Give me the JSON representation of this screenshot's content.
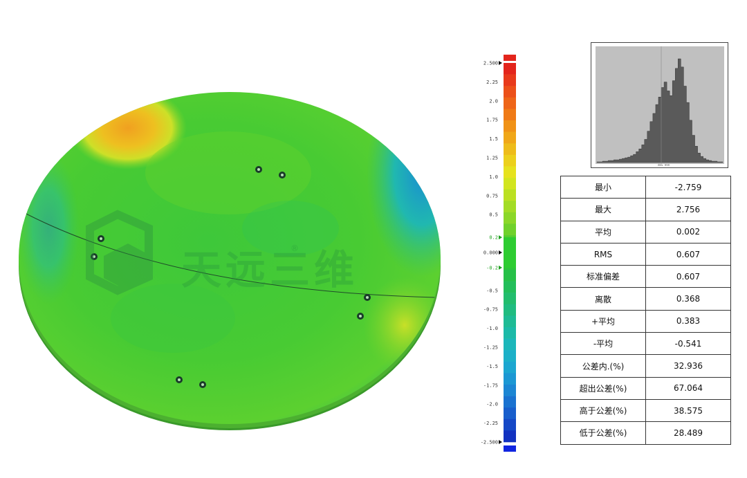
{
  "watermark": {
    "text": "天远三维",
    "reg_mark": "®"
  },
  "colorbar": {
    "labels": [
      "2.500",
      "2.25",
      "2.0",
      "1.75",
      "1.5",
      "1.25",
      "1.0",
      "0.75",
      "0.5",
      "0.2",
      "0.000",
      "-0.2",
      "-0.5",
      "-0.75",
      "-1.0",
      "-1.25",
      "-1.5",
      "-1.75",
      "-2.0",
      "-2.25",
      "-2.500"
    ],
    "colors_top_to_bottom": [
      "#e3251c",
      "#e83a1b",
      "#ec5019",
      "#ee6518",
      "#ef7a16",
      "#f09216",
      "#f0a718",
      "#eebc1a",
      "#ecd01c",
      "#e6e21e",
      "#d2e51f",
      "#bbe022",
      "#a3dc25",
      "#8bd728",
      "#70d12b",
      "#56cd2e",
      "#40c832",
      "#2fc43a",
      "#26c048",
      "#23be5a",
      "#22bd6d",
      "#20bc80",
      "#1ebb95",
      "#1cbaa8",
      "#1cb7ba",
      "#1cb0c8",
      "#1ca6d0",
      "#1c97d3",
      "#1c86d3",
      "#1a72d0",
      "#185ecc",
      "#1548c6",
      "#1232c0"
    ],
    "top_cap_color": "#e3251c",
    "bottom_cap_color": "#1025e0",
    "tolerance_color": "#2ecc31"
  },
  "histogram": {
    "axis_label": "dev. mm",
    "bins": [
      1,
      1,
      2,
      2,
      3,
      3,
      4,
      4,
      5,
      6,
      7,
      8,
      10,
      12,
      16,
      20,
      26,
      34,
      46,
      60,
      72,
      85,
      96,
      110,
      118,
      105,
      98,
      120,
      138,
      152,
      140,
      112,
      88,
      62,
      40,
      24,
      14,
      9,
      6,
      4,
      3,
      2,
      2,
      1,
      1
    ]
  },
  "stats": [
    {
      "label": "最小",
      "value": "-2.759"
    },
    {
      "label": "最大",
      "value": "2.756"
    },
    {
      "label": "平均",
      "value": "0.002"
    },
    {
      "label": "RMS",
      "value": "0.607"
    },
    {
      "label": "标准偏差",
      "value": "0.607"
    },
    {
      "label": "离散",
      "value": "0.368"
    },
    {
      "label": "+平均",
      "value": "0.383"
    },
    {
      "label": "-平均",
      "value": "-0.541"
    },
    {
      "label": "公差内.(%)",
      "value": "32.936"
    },
    {
      "label": "超出公差(%)",
      "value": "67.064"
    },
    {
      "label": "高于公差(%)",
      "value": "38.575"
    },
    {
      "label": "低于公差(%)",
      "value": "28.489"
    }
  ]
}
